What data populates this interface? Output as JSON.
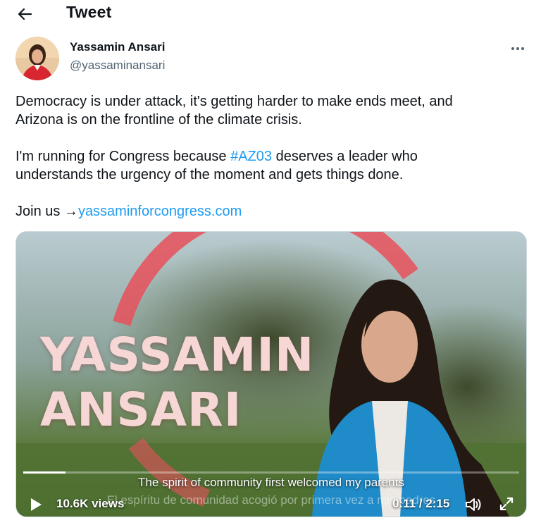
{
  "header": {
    "title": "Tweet",
    "back_icon": "arrow-left-icon"
  },
  "tweet": {
    "author": {
      "name": "Yassamin Ansari",
      "handle": "@yassaminansari"
    },
    "more_icon": "more-horizontal-icon",
    "text": {
      "line1": "Democracy is under attack, it's getting harder to make ends meet, and",
      "line2": "Arizona is on the frontline of the climate crisis.",
      "line3_pre": "I'm running for Congress because ",
      "hashtag": "#AZ03",
      "line3_post": " deserves a leader who",
      "line4": "understands the urgency of the moment and gets things done.",
      "join_pre": "Join us →",
      "link": "yassaminforcongress.com"
    }
  },
  "video": {
    "title_line1": "YASSAMIN",
    "title_line2": "ANSARI",
    "caption_en": "The spirit of community first welcomed my parents",
    "caption_es": "El espíritu de comunidad acogió por primera vez a mis padres",
    "views": "10.6K views",
    "time": "0:11 / 2:15",
    "progress": 0.085,
    "play_icon": "play-icon",
    "volume_icon": "volume-icon",
    "fullscreen_icon": "fullscreen-icon"
  },
  "colors": {
    "link": "#1d9bf0",
    "secondary_text": "#536471",
    "ring": "#e8505b"
  }
}
